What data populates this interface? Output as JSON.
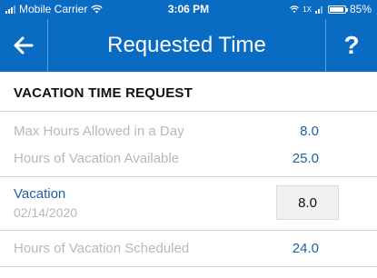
{
  "status": {
    "carrier": "Mobile Carrier",
    "time": "3:06 PM",
    "battery": "85%",
    "battery_level": 0.85,
    "lte": "1X"
  },
  "nav": {
    "title": "Requested Time",
    "back_icon": "arrow-left-icon",
    "help_label": "?"
  },
  "section": {
    "title": "VACATION TIME REQUEST"
  },
  "summary": {
    "max_hours_label": "Max Hours Allowed in a Day",
    "max_hours_value": "8.0",
    "available_label": "Hours of Vacation Available",
    "available_value": "25.0"
  },
  "entry": {
    "type": "Vacation",
    "date": "02/14/2020",
    "hours": "8.0"
  },
  "scheduled": {
    "label": "Hours of Vacation Scheduled",
    "value": "24.0"
  },
  "colors": {
    "brand": "#0a6bc2",
    "value_text": "#1f5fa3",
    "muted_text": "#b8b8b8"
  }
}
